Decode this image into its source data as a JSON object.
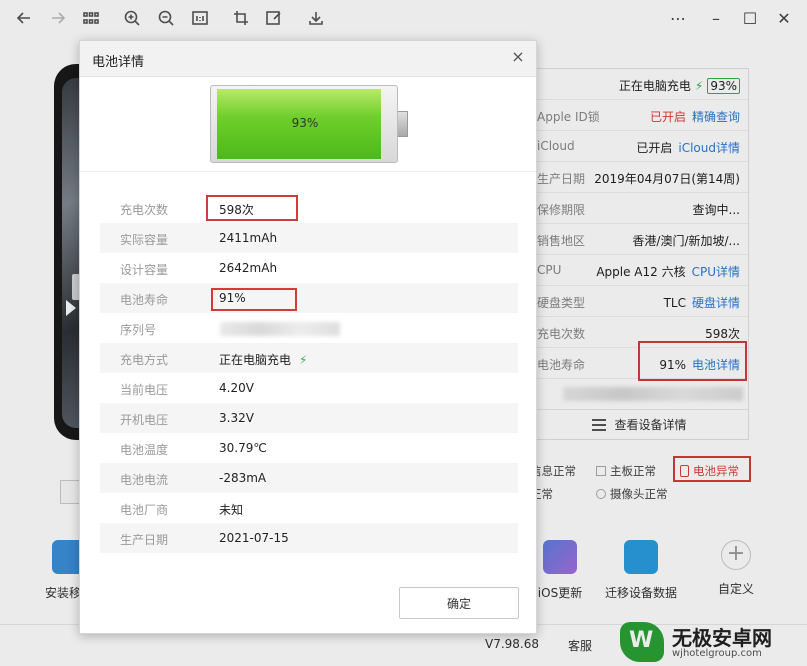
{
  "app": {
    "version": "V7.98.68",
    "service_label": "客服"
  },
  "background": {
    "info_rows": [
      {
        "label": "",
        "value": "正在电脑充电",
        "badge": "93%"
      },
      {
        "label": "Apple ID锁",
        "value": "已开启",
        "link": "精确查询"
      },
      {
        "label": "iCloud",
        "value": "已开启",
        "link": "iCloud详情"
      },
      {
        "label": "生产日期",
        "value": "2019年04月07日(第14周)"
      },
      {
        "label": "保修期限",
        "value": "查询中..."
      },
      {
        "label": "销售地区",
        "value": "香港/澳门/新加坡/..."
      },
      {
        "label": "CPU",
        "value": "Apple A12 六核",
        "link": "CPU详情"
      },
      {
        "label": "硬盘类型",
        "value": "TLC",
        "link": "硬盘详情"
      },
      {
        "label": "充电次数",
        "value": "598次"
      },
      {
        "label": "电池寿命",
        "value": "91%",
        "link": "电池详情"
      }
    ],
    "detail_button": "查看设备详情",
    "health": {
      "item1": "信息正常",
      "item2": "主板正常",
      "item3": "电池异常",
      "item4": "正常",
      "item5": "摄像头正常"
    },
    "tools": [
      {
        "label": "安装移动"
      },
      {
        "label": "iOS更新"
      },
      {
        "label": "迁移设备数据"
      },
      {
        "label": "自定义"
      }
    ]
  },
  "dialog": {
    "title": "电池详情",
    "close_symbol": "×",
    "battery_level_text": "93%",
    "battery_level": 0.93,
    "rows": [
      {
        "label": "充电次数",
        "value": "598次"
      },
      {
        "label": "实际容量",
        "value": "2411mAh"
      },
      {
        "label": "设计容量",
        "value": "2642mAh"
      },
      {
        "label": "电池寿命",
        "value": "91%"
      },
      {
        "label": "序列号",
        "value": ""
      },
      {
        "label": "充电方式",
        "value": "正在电脑充电"
      },
      {
        "label": "当前电压",
        "value": "4.20V"
      },
      {
        "label": "开机电压",
        "value": "3.32V"
      },
      {
        "label": "电池温度",
        "value": "30.79℃"
      },
      {
        "label": "电池电流",
        "value": "-283mA"
      },
      {
        "label": "电池厂商",
        "value": "未知"
      },
      {
        "label": "生产日期",
        "value": "2021-07-15"
      }
    ],
    "ok_label": "确定"
  },
  "watermark": {
    "logo_char": "W",
    "name": "无极安卓网",
    "url": "wjhotelgroup.com"
  },
  "colors": {
    "accent": "#2b7bd6",
    "highlight": "#d53a3a",
    "charging": "#2fb34a",
    "battery_fill": "#6fcf2b"
  }
}
